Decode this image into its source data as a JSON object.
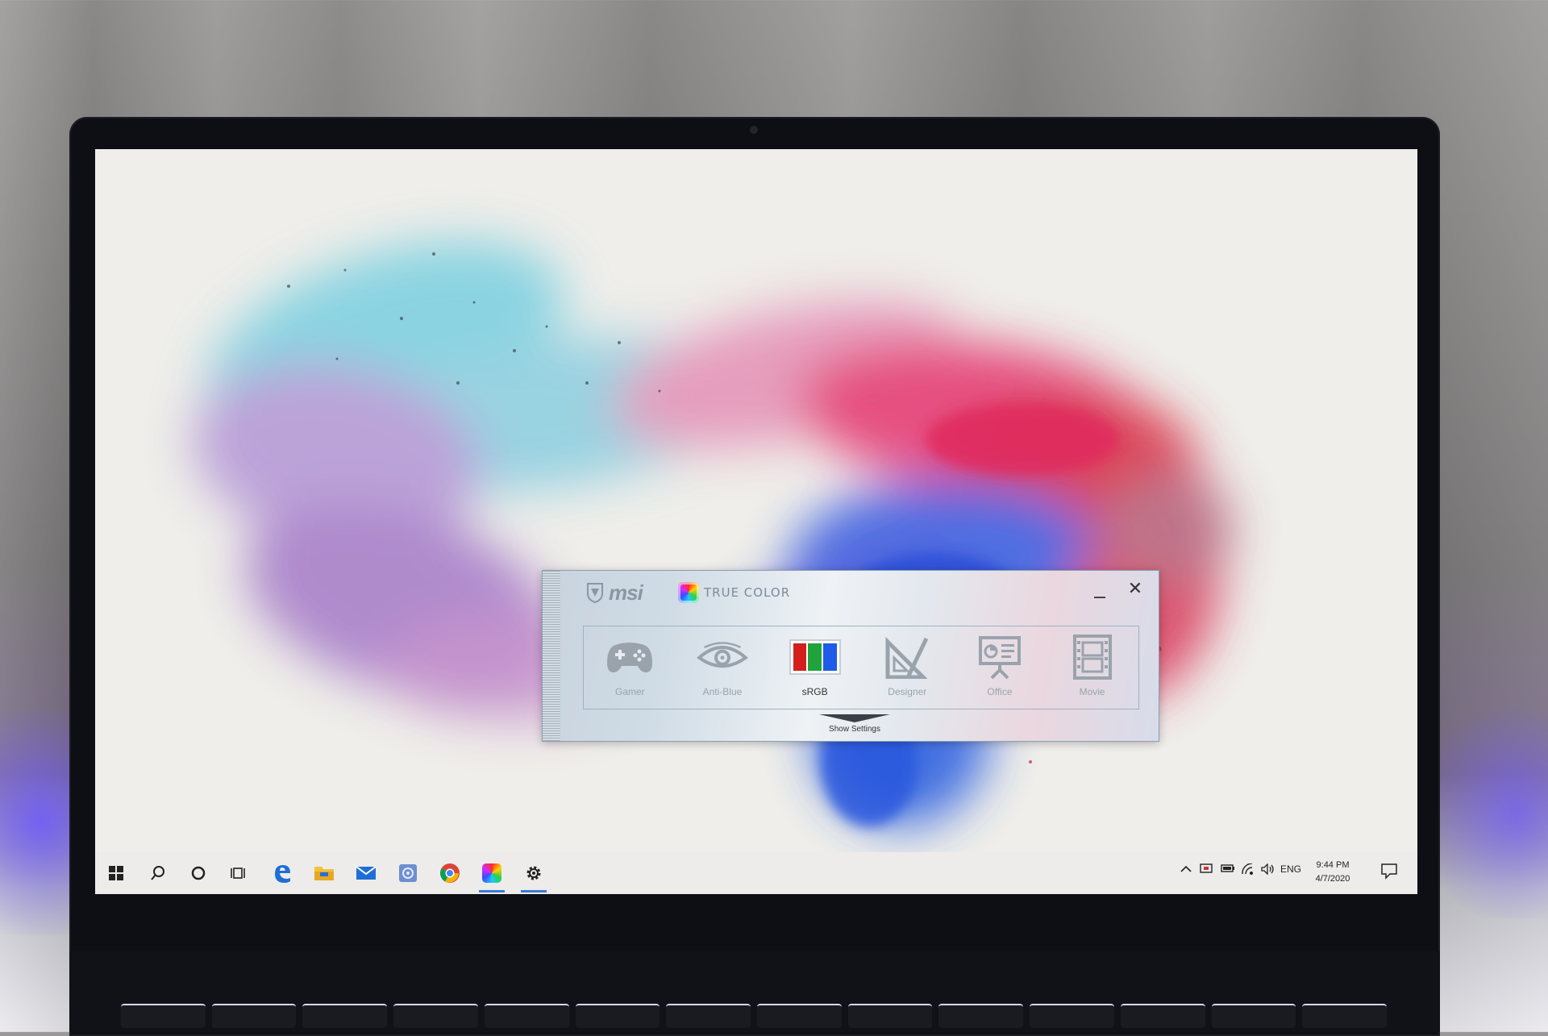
{
  "app": {
    "brand_logo": "msi",
    "product_name": "TRUE COLOR"
  },
  "window_controls": {
    "minimize_icon": "minimize-icon",
    "close_icon": "close-icon",
    "close_glyph": "✕"
  },
  "modes": [
    {
      "label": "Gamer",
      "icon": "gamepad-icon",
      "active": false
    },
    {
      "label": "Anti-Blue",
      "icon": "eye-icon",
      "active": false
    },
    {
      "label": "sRGB",
      "icon": "srgb-icon",
      "active": true
    },
    {
      "label": "Designer",
      "icon": "triangle-ruler-icon",
      "active": false
    },
    {
      "label": "Office",
      "icon": "presentation-icon",
      "active": false
    },
    {
      "label": "Movie",
      "icon": "film-icon",
      "active": false
    }
  ],
  "show_settings": {
    "label": "Show Settings",
    "icon": "chevron-down-icon"
  },
  "taskbar": {
    "pinned": [
      {
        "name": "start-button",
        "icon": "windows-icon"
      },
      {
        "name": "search-button",
        "icon": "search-icon"
      },
      {
        "name": "cortana-button",
        "icon": "circle-icon"
      },
      {
        "name": "task-view-button",
        "icon": "task-view-icon"
      },
      {
        "name": "edge-app",
        "icon": "edge-icon"
      },
      {
        "name": "file-explorer-app",
        "icon": "folder-icon"
      },
      {
        "name": "mail-app",
        "icon": "mail-icon"
      },
      {
        "name": "photo-app",
        "icon": "photos-icon"
      },
      {
        "name": "chrome-app",
        "icon": "chrome-icon"
      },
      {
        "name": "true-color-app",
        "icon": "true-color-icon"
      },
      {
        "name": "settings-app",
        "icon": "gear-icon"
      }
    ],
    "tray": {
      "language": "ENG",
      "time": "9:44 PM",
      "date": "4/7/2020"
    }
  },
  "colors": {
    "srgb_red": "#d41e1e",
    "srgb_green": "#1fa33a",
    "srgb_blue": "#1e5be8",
    "taskbar_accent": "#3c7bd8"
  }
}
